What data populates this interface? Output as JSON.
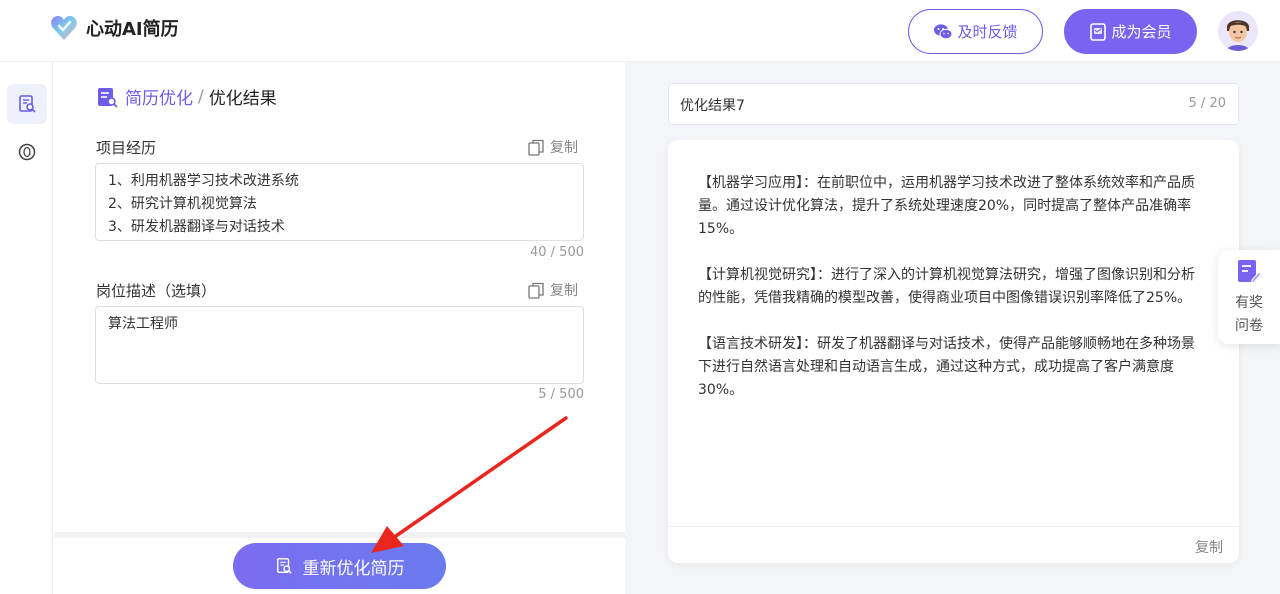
{
  "header": {
    "app_name": "心动AI简历",
    "feedback_label": "及时反馈",
    "vip_label": "成为会员"
  },
  "breadcrumb": {
    "parent": "简历优化",
    "separator": "/",
    "current": "优化结果"
  },
  "project": {
    "label": "项目经历",
    "copy_label": "复制",
    "lines": [
      "1、利用机器学习技术改进系统",
      "2、研究计算机视觉算法",
      "3、研发机器翻译与对话技术"
    ],
    "counter": "40 / 500"
  },
  "position": {
    "label": "岗位描述（选填）",
    "copy_label": "复制",
    "value": "算法工程师",
    "counter": "5 / 500"
  },
  "actions": {
    "reoptimize_label": "重新优化简历"
  },
  "result": {
    "title_value": "优化结果7",
    "title_counter": "5 / 20",
    "paragraphs": [
      "【机器学习应用】：在前职位中，运用机器学习技术改进了整体系统效率和产品质量。通过设计优化算法，提升了系统处理速度20%，同时提高了整体产品准确率15%。",
      "【计算机视觉研究】：进行了深入的计算机视觉算法研究，增强了图像识别和分析的性能，凭借我精确的模型改善，使得商业项目中图像错误识别率降低了25%。",
      "【语言技术研发】：研发了机器翻译与对话技术，使得产品能够顺畅地在多种场景下进行自然语言处理和自动语言生成，通过这种方式，成功提高了客户满意度30%。"
    ],
    "copy_label": "复制"
  },
  "survey": {
    "line1": "有奖",
    "line2": "问卷"
  },
  "icons": {
    "logo": "heart-logo-icon",
    "feedback": "wechat-icon",
    "vip": "vip-card-icon",
    "rail_1": "resume-search-icon",
    "rail_2": "coin-icon",
    "crumb": "resume-doc-icon",
    "copy": "copy-icon",
    "survey": "survey-edit-icon",
    "reoptimize": "resume-search-icon"
  },
  "colors": {
    "accent": "#6c5ce7",
    "vip_bg": "#7a63f0",
    "arrow": "#e8261e"
  }
}
